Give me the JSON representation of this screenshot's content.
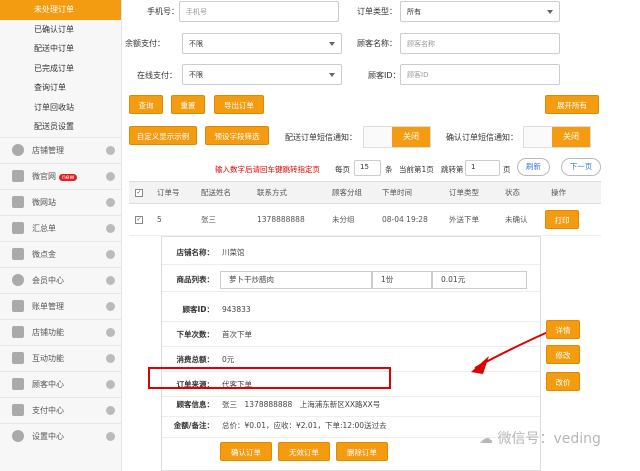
{
  "sidebar": {
    "subitems": [
      "未处理订单",
      "已确认订单",
      "配送中订单",
      "已完成订单",
      "查询订单",
      "订单回收站",
      "配送员设置"
    ],
    "groups": [
      {
        "label": "店铺管理",
        "icon": "pie-chart-icon"
      },
      {
        "label": "微官网",
        "icon": "grid-icon",
        "badge": "new"
      },
      {
        "label": "微网站",
        "icon": "grid-icon"
      },
      {
        "label": "汇总单",
        "icon": "grid-icon"
      },
      {
        "label": "微点金",
        "icon": "grid-icon"
      },
      {
        "label": "会员中心",
        "icon": "pie-chart-icon"
      },
      {
        "label": "账单管理",
        "icon": "printer-icon"
      },
      {
        "label": "店铺功能",
        "icon": "plus-icon"
      },
      {
        "label": "互动功能",
        "icon": "plus-icon"
      },
      {
        "label": "顾客中心",
        "icon": "inbox-icon"
      },
      {
        "label": "支付中心",
        "icon": "inbox-icon"
      },
      {
        "label": "设置中心",
        "icon": "gear-icon"
      }
    ]
  },
  "filters": {
    "phone_label": "手机号：",
    "phone_placeholder": "手机号",
    "order_type_label": "订单类型：",
    "order_type_value": "所有",
    "balance_label": "余额支付：",
    "balance_value": "不限",
    "customer_name_label": "顾客名称：",
    "customer_name_placeholder": "顾客名称",
    "online_label": "在线支付：",
    "online_value": "不限",
    "customer_id_label": "顾客ID：",
    "customer_id_placeholder": "顾客ID"
  },
  "buttons": {
    "query": "查询",
    "reset": "重置",
    "export": "导出订单",
    "expand_all": "展开所有",
    "custom_example": "自定义显示示例",
    "preset_filter": "预设字段筛选"
  },
  "sms": {
    "delivery_label": "配送订单短信通知：",
    "delivery_value": "关闭",
    "order_label": "确认订单短信通知：",
    "order_value": "关闭"
  },
  "pager": {
    "hint": "输入数字后请回车键跳转指定页",
    "per_page_label": "每页",
    "per_page_value": "15",
    "unit": "条",
    "current": "当前第1页",
    "jump_label": "跳转第",
    "jump_value": "1",
    "page_unit": "页",
    "refresh": "刷新",
    "next": "下一页"
  },
  "table": {
    "headers": [
      "订单号",
      "配送姓名",
      "联系方式",
      "顾客分组",
      "下单时间",
      "订单类型",
      "状态",
      "操作"
    ],
    "rows": [
      {
        "id": "5",
        "name": "张三",
        "phone": "1378888888",
        "group": "未分组",
        "time": "08-04 19:28",
        "type": "外送下单",
        "status": "未确认",
        "action": "打印"
      }
    ]
  },
  "detail": {
    "shop_label": "店铺名称：",
    "shop_value": "川菜馆",
    "goods_label": "商品列表：",
    "goods_name": "萝卜干炒腊肉",
    "goods_qty": "1份",
    "goods_price": "0.01元",
    "cid_label": "顾客ID：",
    "cid_value": "943833",
    "count_label": "下单次数：",
    "count_value": "首次下单",
    "total_label": "消费总额：",
    "total_value": "0元",
    "source_label": "订单来源：",
    "source_value": "代客下单",
    "info_label": "顾客信息：",
    "info_value": "张三　1378888888　上海浦东新区XX路XX号",
    "amount_label": "金额/备注：",
    "amount_value": "总价：¥0.01，应收：¥2.01，下单:12:00送过去",
    "buttons": [
      "确认订单",
      "无效订单",
      "删除订单"
    ],
    "side_buttons": [
      "详情",
      "修改",
      "改价"
    ]
  },
  "watermark": "微信号：veding",
  "colors": {
    "accent": "#f39c12",
    "highlight": "#e00000"
  }
}
